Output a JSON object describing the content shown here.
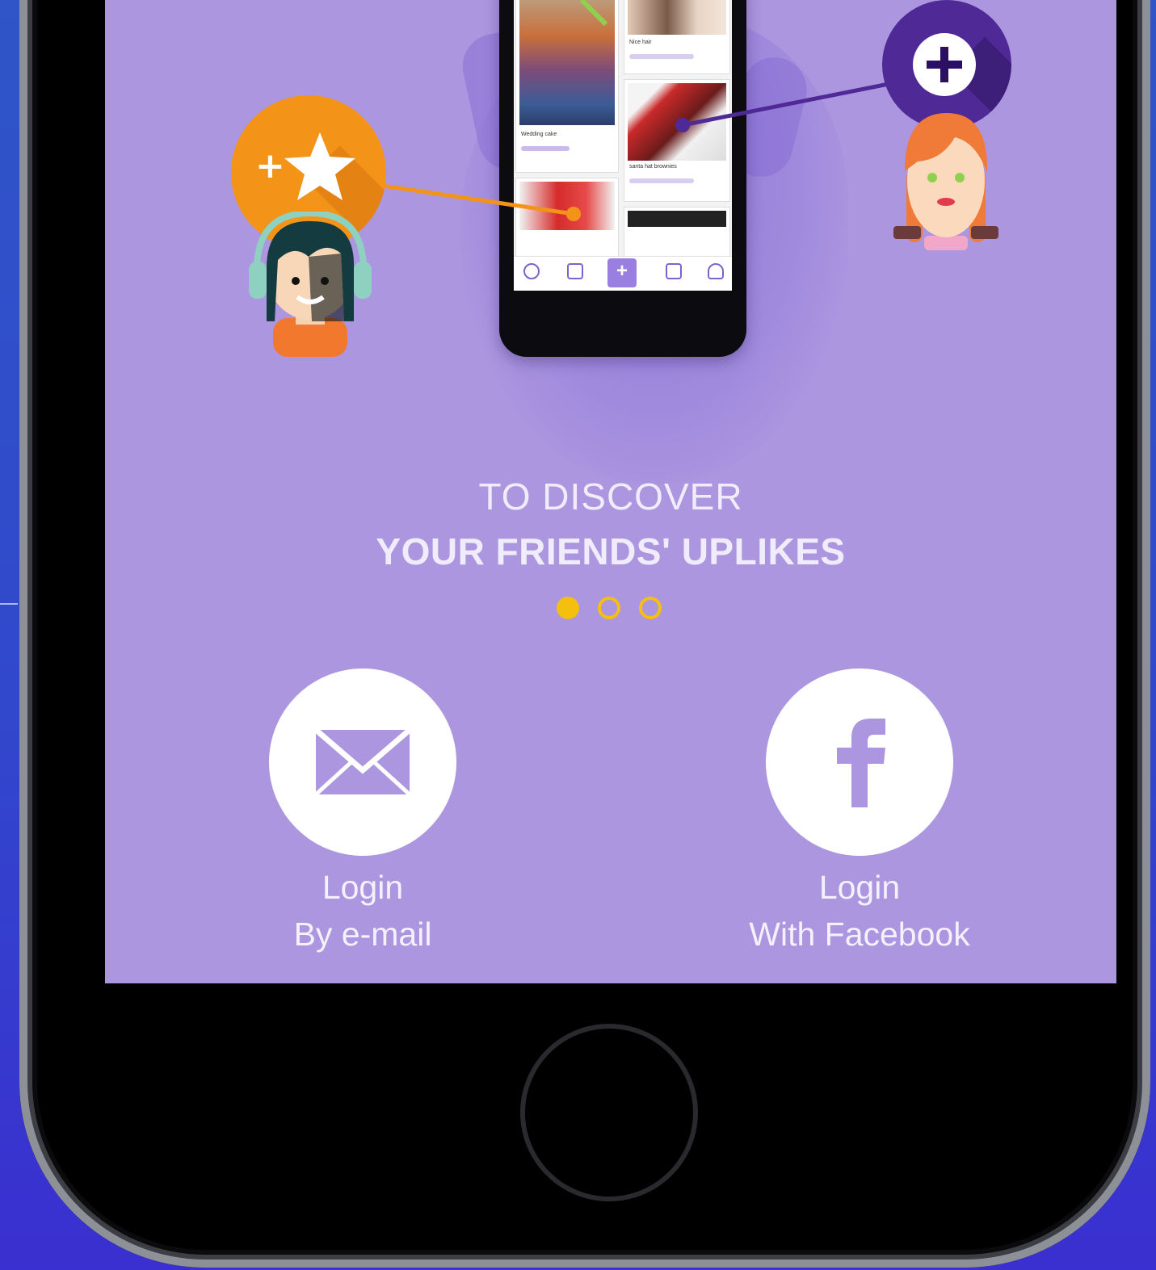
{
  "onboarding": {
    "headline_line1": "TO DISCOVER",
    "headline_line2": "YOUR FRIENDS' UPLIKES",
    "pager": {
      "page_count": 3,
      "active_index": 0
    }
  },
  "login_options": {
    "email": {
      "line1": "Login",
      "line2": "By e-mail",
      "icon": "envelope-icon"
    },
    "facebook": {
      "line1": "Login",
      "line2": "With Facebook",
      "icon": "facebook-icon"
    }
  },
  "preview_phone": {
    "cards": [
      "Wedding cake",
      "Nice hair",
      "santa hat brownies"
    ]
  },
  "colors": {
    "screen_bg": "#ac96e0",
    "accent_orange": "#f39419",
    "accent_purple": "#4f2a96",
    "pager_active": "#f5bf10"
  }
}
